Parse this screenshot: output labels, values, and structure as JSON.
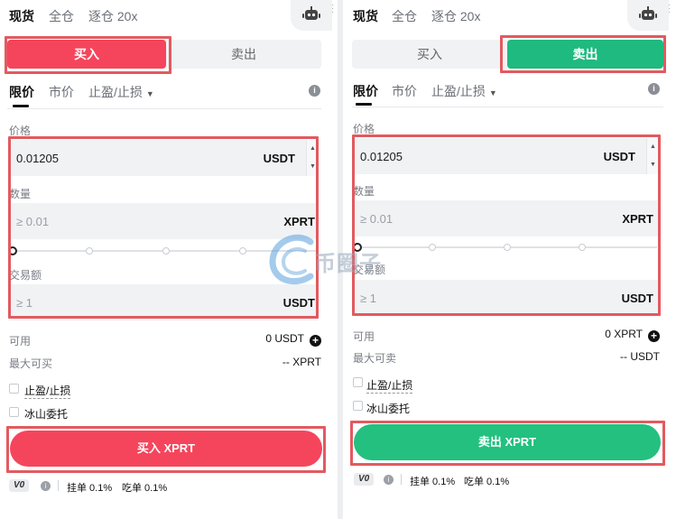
{
  "colors": {
    "buy": "#f5455c",
    "sell": "#23c07f",
    "highlight": "#e25a5f"
  },
  "left": {
    "top_tabs": [
      "现货",
      "全仓",
      "逐仓 20x"
    ],
    "robot_icon": "robot-icon",
    "side_buy": "买入",
    "side_sell": "卖出",
    "order_types": [
      "限价",
      "市价",
      "止盈/止损"
    ],
    "price_label": "价格",
    "price_value": "0.01205",
    "price_unit": "USDT",
    "qty_label": "数量",
    "qty_placeholder": "≥ 0.01",
    "qty_unit": "XPRT",
    "total_label": "交易额",
    "total_placeholder": "≥ 1",
    "total_unit": "USDT",
    "available_label": "可用",
    "available_value": "0 USDT",
    "max_label": "最大可买",
    "max_value": "-- XPRT",
    "tpsl_label": "止盈/止损",
    "iceberg_label": "冰山委托",
    "submit_label": "买入 XPRT",
    "vip_level": "V0",
    "maker_fee": "挂单 0.1%",
    "taker_fee": "吃单 0.1%"
  },
  "right": {
    "top_tabs": [
      "现货",
      "全仓",
      "逐仓 20x"
    ],
    "robot_icon": "robot-icon",
    "side_buy": "买入",
    "side_sell": "卖出",
    "order_types": [
      "限价",
      "市价",
      "止盈/止损"
    ],
    "price_label": "价格",
    "price_value": "0.01205",
    "price_unit": "USDT",
    "qty_label": "数量",
    "qty_placeholder": "≥ 0.01",
    "qty_unit": "XPRT",
    "total_label": "交易额",
    "total_placeholder": "≥ 1",
    "total_unit": "USDT",
    "available_label": "可用",
    "available_value": "0 XPRT",
    "max_label": "最大可卖",
    "max_value": "-- USDT",
    "tpsl_label": "止盈/止损",
    "iceberg_label": "冰山委托",
    "submit_label": "卖出 XPRT",
    "vip_level": "V0",
    "maker_fee": "挂单 0.1%",
    "taker_fee": "吃单 0.1%"
  },
  "watermark_text": "币圈子"
}
